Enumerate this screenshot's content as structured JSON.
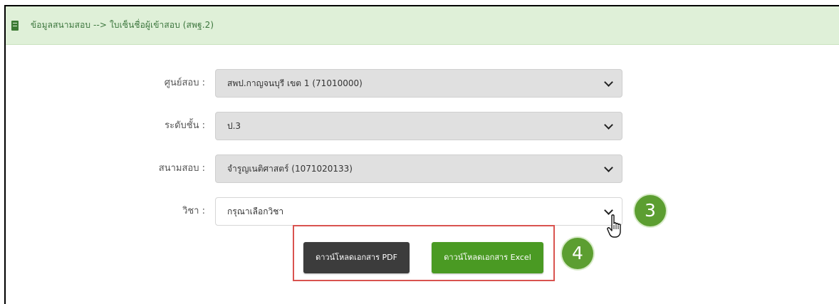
{
  "header": {
    "title": "ข้อมูลสนามสอบ --> ใบเซ็นชื่อผู้เข้าสอบ (สพฐ.2)",
    "icon": "building-icon"
  },
  "form": {
    "center": {
      "label": "ศูนย์สอบ :",
      "value": "สพป.กาญจนบุรี เขต 1 (71010000)"
    },
    "level": {
      "label": "ระดับชั้น :",
      "value": "ป.3"
    },
    "site": {
      "label": "สนามสอบ :",
      "value": "จำรูญเนติศาสตร์ (1071020133)"
    },
    "subject": {
      "label": "วิชา :",
      "value": "กรุณาเลือกวิชา"
    }
  },
  "buttons": {
    "pdf_label": "ดาวน์โหลดเอกสาร PDF",
    "excel_label": "ดาวน์โหลดเอกสาร Excel"
  },
  "annotations": {
    "step3": "3",
    "step4": "4"
  },
  "colors": {
    "header_bg": "#dff0d8",
    "header_text": "#3c763d",
    "pdf_button": "#3c3c3c",
    "excel_button": "#4a9a23",
    "badge": "#5c9e31",
    "highlight_box": "#d9534f"
  }
}
